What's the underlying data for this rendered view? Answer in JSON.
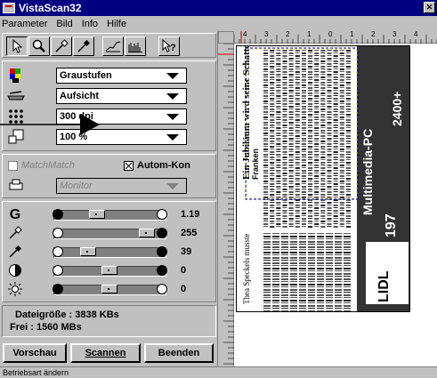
{
  "window": {
    "title": "VistaScan32",
    "close_glyph": "✕"
  },
  "menu": [
    {
      "label": "Parameter"
    },
    {
      "label": "Bild"
    },
    {
      "label": "Info"
    },
    {
      "label": "Hilfe"
    }
  ],
  "toolbar": {
    "tools": [
      "pointer-tool",
      "zoom-tool",
      "white-point-picker",
      "black-point-picker",
      "histogram-curve",
      "histogram-bars",
      "help-pointer"
    ]
  },
  "settings": {
    "mode": "Graustufen",
    "source": "Aufsicht",
    "resolution": "300 dpi",
    "scale": "100 %"
  },
  "options": {
    "match_label": "MatchMatch",
    "autocontrast_label": "Autom-Kon",
    "autocontrast_checked": true,
    "printer_combo": "Monitor"
  },
  "sliders": [
    {
      "label": "G",
      "value": "1.19",
      "position": 0.32
    },
    {
      "label": "",
      "value": "255",
      "position": 0.98
    },
    {
      "label": "",
      "value": "39",
      "position": 0.2
    },
    {
      "label": "",
      "value": "0",
      "position": 0.48
    },
    {
      "label": "",
      "value": "0",
      "position": 0.48
    }
  ],
  "info": {
    "filesize": "Dateigröße : 3838 KBs",
    "free": "Frei : 1560 MBs"
  },
  "buttons": {
    "preview": "Vorschau",
    "scan": "Scannen",
    "exit": "Beenden"
  },
  "status": "Betriebsart ändern",
  "ruler": {
    "numbers": [
      "4",
      "3",
      "2",
      "1",
      "0",
      "1",
      "2",
      "3",
      "4"
    ]
  },
  "preview_text": {
    "headline": "Ein Jubiläum wird seine Schatten werfen",
    "subline": "Thea Speckels musste",
    "franken": "Franken",
    "brand": "Multimedia-PC",
    "price": "2400+",
    "number": "197",
    "logo": "LIDL"
  }
}
